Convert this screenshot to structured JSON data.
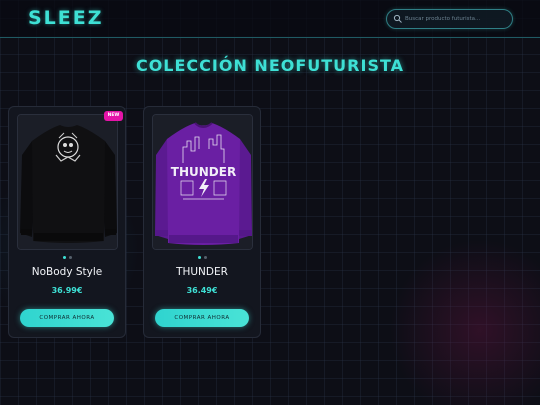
{
  "header": {
    "logo": "SLEEZ",
    "search": {
      "placeholder": "Buscar producto futurista..."
    }
  },
  "main": {
    "title": "COLECCIÓN NEOFUTURISTA",
    "products": [
      {
        "name": "NoBody Style",
        "price": "36.99€",
        "badge": "NEW",
        "button_label": "COMPRAR AHORA",
        "image_color": "#111111",
        "carousel": {
          "slides": 2,
          "active": 1
        }
      },
      {
        "name": "THUNDER",
        "price": "36.49€",
        "image_text": "THUNDER",
        "button_label": "COMPRAR AHORA",
        "image_color": "#6a1fa3",
        "carousel": {
          "slides": 2,
          "active": 1
        }
      }
    ]
  },
  "colors": {
    "accent": "#3ee0d5",
    "badge": "#e514a8",
    "background": "#0d0e16"
  }
}
